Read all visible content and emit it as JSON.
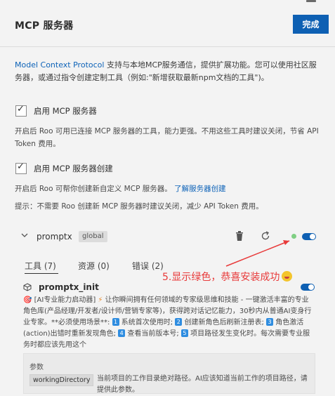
{
  "header": {
    "title": "MCP 服务器",
    "done_label": "完成"
  },
  "intro": {
    "link_text": "Model Context Protocol",
    "text": " 支持与本地MCP服务通信，提供扩展功能。您可以使用社区服务器，或通过指令创建定制工具（例如:\"新增获取最新npm文档的工具\")。"
  },
  "enable_mcp": {
    "checked": true,
    "label": "启用 MCP 服务器",
    "help": "开启后 Roo 可用已连接 MCP 服务器的工具，能力更强。不用这些工具时建议关闭，节省 API Token 费用。"
  },
  "enable_create": {
    "checked": true,
    "label": "启用 MCP 服务器创建",
    "help_text": "开启后 Roo 可帮你创建新自定义 MCP 服务器。",
    "help_link": "了解服务器创建",
    "tip": "提示：不需要 Roo 创建新 MCP 服务器时建议关闭，减少 API Token 费用。"
  },
  "server": {
    "name": "promptx",
    "scope_badge": "global",
    "status_color": "#7fcf83",
    "enabled": true
  },
  "tabs": [
    {
      "label": "工具 (7)",
      "active": true
    },
    {
      "label": "资源 (0)",
      "active": false
    },
    {
      "label": "错误 (2)",
      "active": false
    }
  ],
  "annotation": {
    "text": "5.显示绿色，恭喜安装成功",
    "color": "#e83a3a"
  },
  "tool": {
    "name": "promptx_init",
    "desc_head": "🎯 [AI专业能力启动器] ",
    "desc_body": " 让你瞬间拥有任何领域的专家级思维和技能 - 一键激活丰富的专业角色库(产品经理/开发者/设计师/营销专家等)，获得跨对话记忆能力，30秒内从普通AI变身行业专家。**必须使用场景**: ",
    "items": [
      {
        "num": "1",
        "text": "系统首次使用时; "
      },
      {
        "num": "2",
        "text": "创建新角色后刷新注册表; "
      },
      {
        "num": "3",
        "text": "角色激活(action)出错时重新发现角色; "
      },
      {
        "num": "4",
        "text": "查看当前版本号; "
      },
      {
        "num": "5",
        "text": "项目路径发生变化时。"
      }
    ],
    "desc_tail": "每次需要专业服务时都应该先用这个",
    "enabled": true
  },
  "params": {
    "title": "参数",
    "name": "workingDirectory",
    "desc": "当前项目的工作目录绝对路径。AI应该知道当前工作的项目路径，请提供此参数。"
  }
}
